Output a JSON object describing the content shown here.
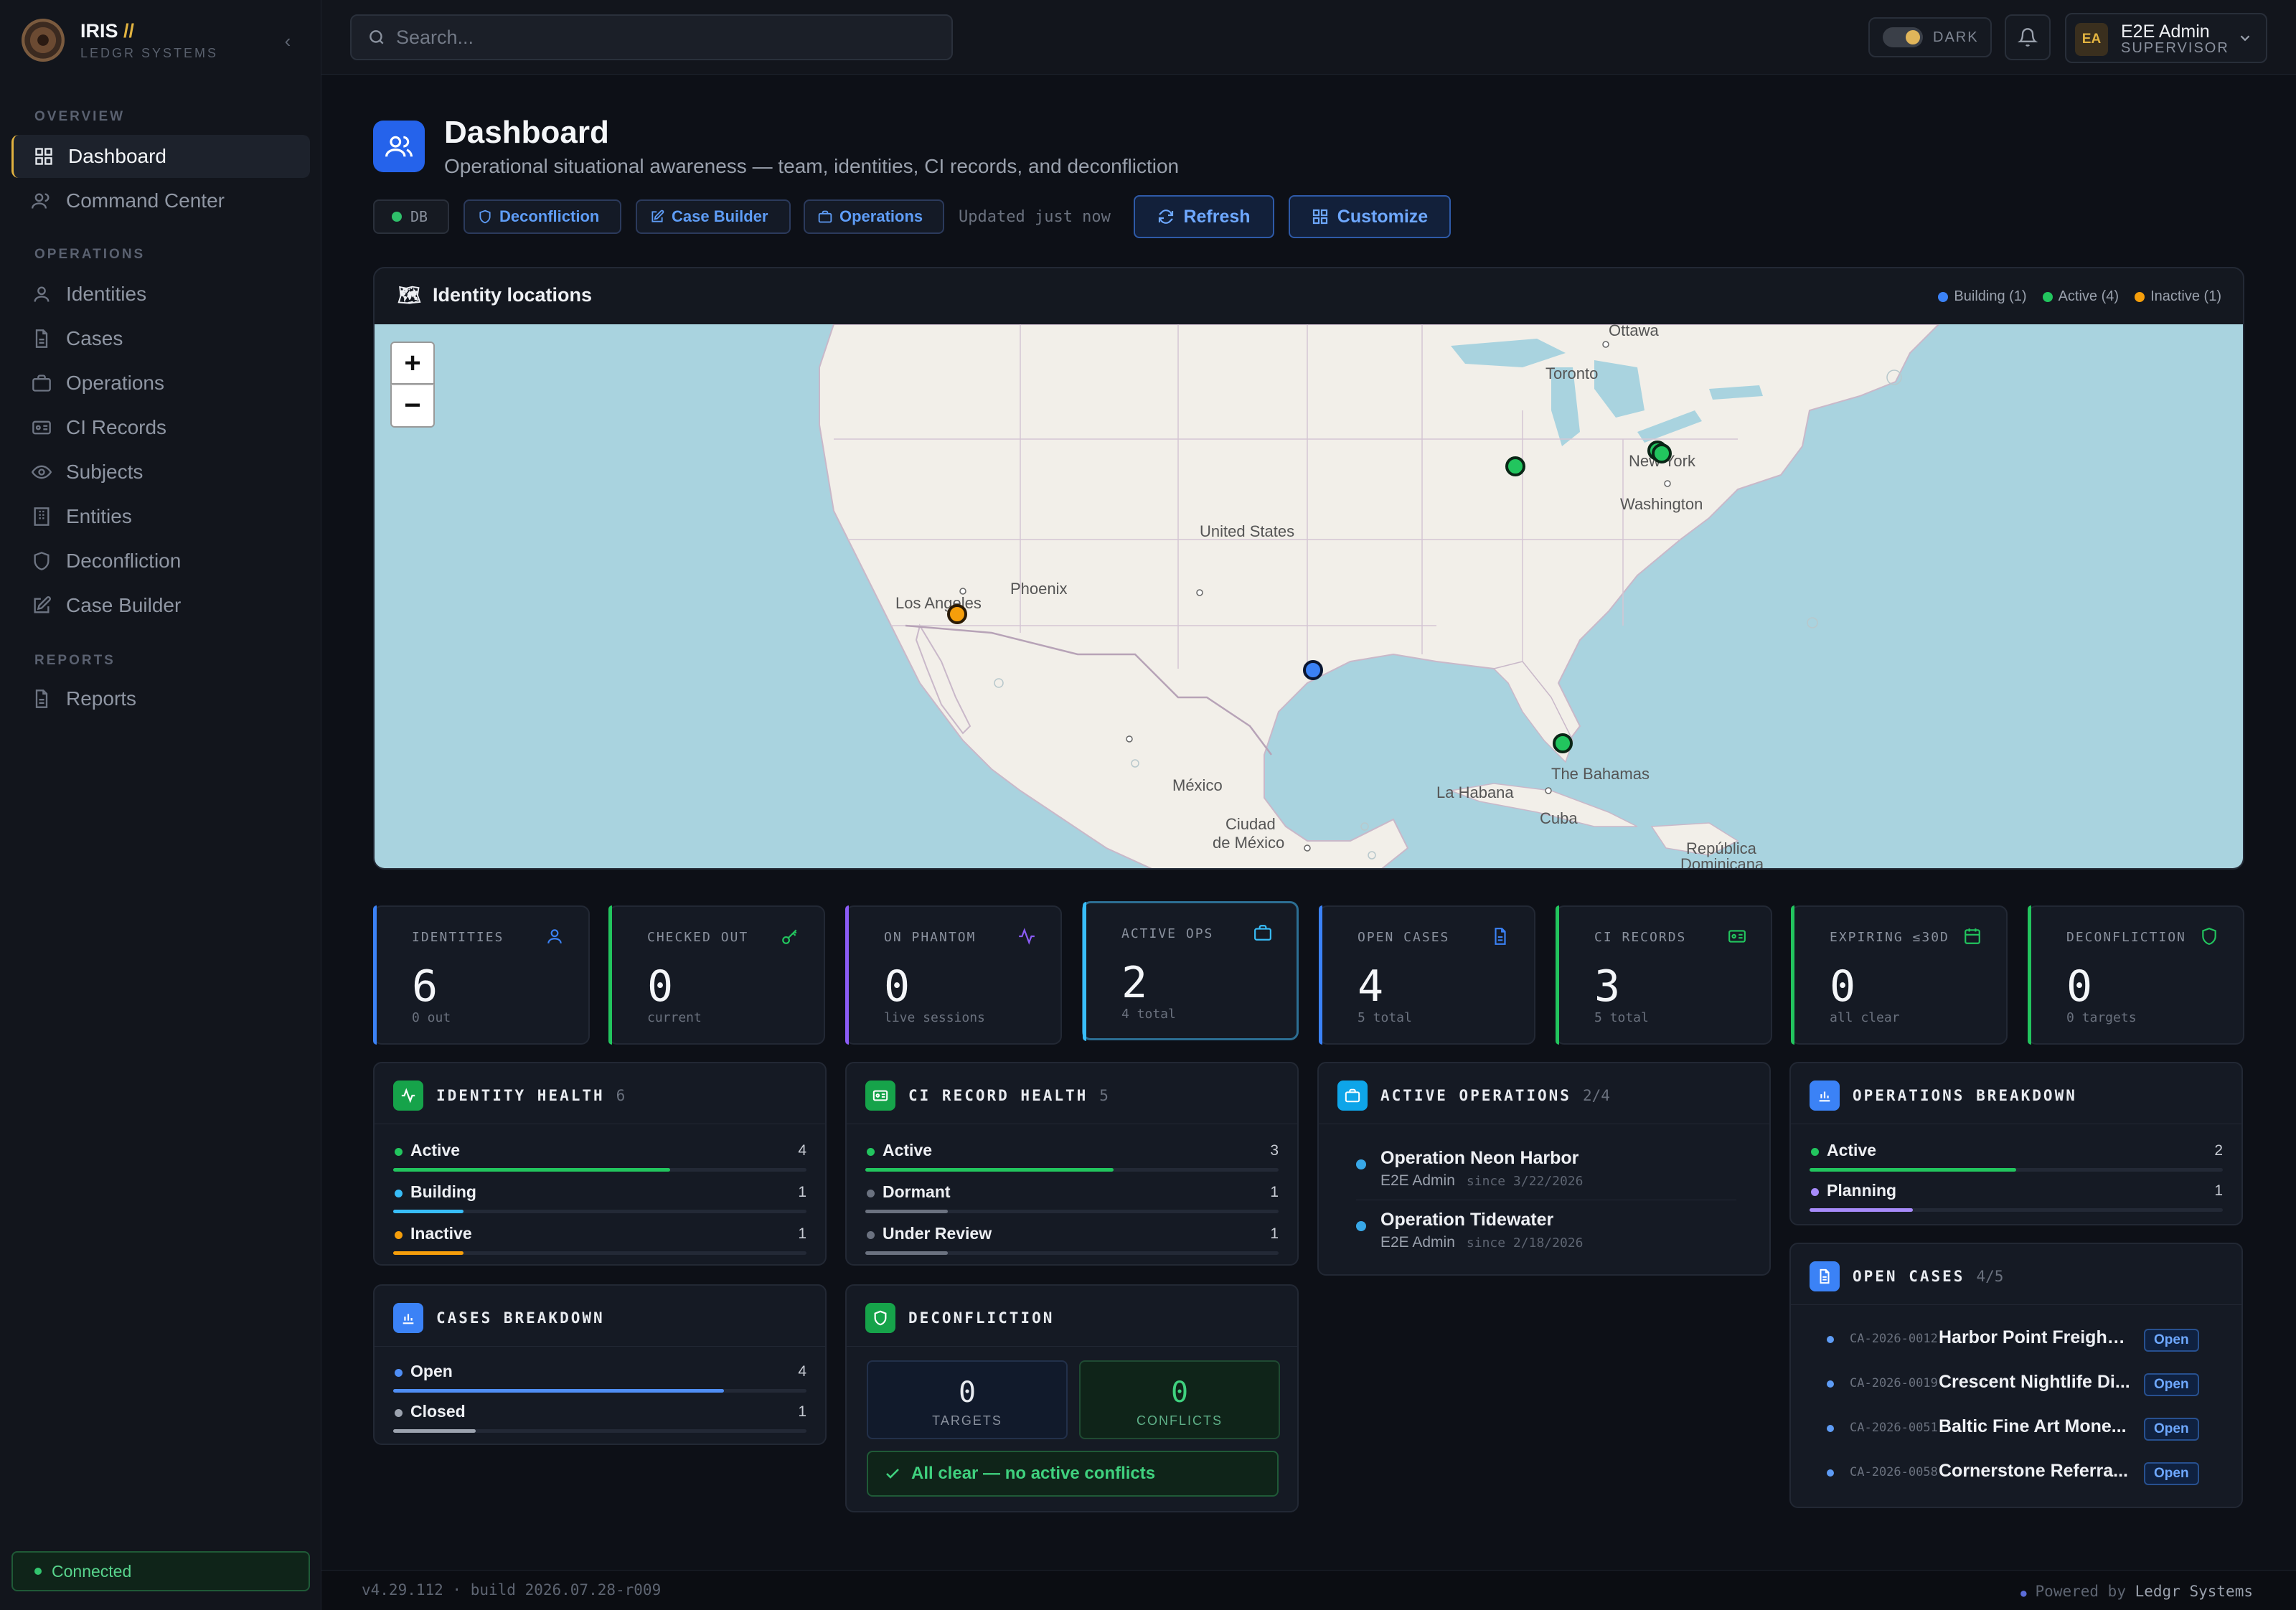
{
  "app": {
    "name": "IRIS",
    "slashes": "//",
    "subtitle": "LEDGR SYSTEMS"
  },
  "sidebar": {
    "sections": [
      {
        "title": "OVERVIEW"
      },
      {
        "title": "OPERATIONS"
      },
      {
        "title": "REPORTS"
      }
    ],
    "items": [
      {
        "label": "Dashboard",
        "icon": "grid-icon",
        "active": true
      },
      {
        "label": "Command Center",
        "icon": "users-icon"
      },
      {
        "label": "Identities",
        "icon": "user-icon"
      },
      {
        "label": "Cases",
        "icon": "file-icon"
      },
      {
        "label": "Operations",
        "icon": "briefcase-icon"
      },
      {
        "label": "CI Records",
        "icon": "id-card-icon"
      },
      {
        "label": "Subjects",
        "icon": "eye-icon"
      },
      {
        "label": "Entities",
        "icon": "building-icon"
      },
      {
        "label": "Deconfliction",
        "icon": "shield-icon"
      },
      {
        "label": "Case Builder",
        "icon": "edit-icon"
      },
      {
        "label": "Reports",
        "icon": "file-icon"
      }
    ],
    "status": "Connected"
  },
  "topbar": {
    "search_placeholder": "Search...",
    "theme_label": "DARK",
    "user": {
      "initials": "EA",
      "name": "E2E Admin",
      "role": "SUPERVISOR"
    }
  },
  "header": {
    "title": "Dashboard",
    "subtitle": "Operational situational awareness — team, identities, CI records, and deconfliction",
    "db_label": "DB",
    "chips": [
      "Deconfliction",
      "Case Builder",
      "Operations"
    ],
    "updated": "Updated just now",
    "refresh": "Refresh",
    "customize": "Customize"
  },
  "map": {
    "title": "Identity locations",
    "legend": [
      {
        "label": "Building (1)",
        "color": "#3b82f6"
      },
      {
        "label": "Active (4)",
        "color": "#22c55e"
      },
      {
        "label": "Inactive (1)",
        "color": "#f59e0b"
      }
    ],
    "zoom_in": "+",
    "zoom_out": "−",
    "labels": [
      "Ottawa",
      "Toronto",
      "New York",
      "Washington",
      "United States",
      "Phoenix",
      "Los Angeles",
      "México",
      "Ciudad",
      "de México",
      "La Habana",
      "The Bahamas",
      "Cuba",
      "República",
      "Dominicana"
    ]
  },
  "stats": [
    {
      "label": "IDENTITIES",
      "value": "6",
      "sub": "0 out",
      "color": "#3b82f6",
      "icon": "user-icon"
    },
    {
      "label": "CHECKED OUT",
      "value": "0",
      "sub": "current",
      "color": "#22c55e",
      "icon": "key-icon"
    },
    {
      "label": "ON PHANTOM",
      "value": "0",
      "sub": "live sessions",
      "color": "#8b5cf6",
      "icon": "activity-icon"
    },
    {
      "label": "ACTIVE OPS",
      "value": "2",
      "sub": "4 total",
      "color": "#38bdf8",
      "icon": "briefcase-icon"
    },
    {
      "label": "OPEN CASES",
      "value": "4",
      "sub": "5 total",
      "color": "#3b82f6",
      "icon": "file-icon"
    },
    {
      "label": "CI RECORDS",
      "value": "3",
      "sub": "5 total",
      "color": "#22c55e",
      "icon": "id-card-icon"
    },
    {
      "label": "EXPIRING ≤30D",
      "value": "0",
      "sub": "all clear",
      "color": "#22c55e",
      "icon": "calendar-icon"
    },
    {
      "label": "DECONFLICTION",
      "value": "0",
      "sub": "0 targets",
      "color": "#22c55e",
      "icon": "shield-icon"
    }
  ],
  "identity_health": {
    "title": "IDENTITY HEALTH",
    "count": "6",
    "rows": [
      {
        "label": "Active",
        "value": "4",
        "fraction": 0.67,
        "color": "#22c55e"
      },
      {
        "label": "Building",
        "value": "1",
        "fraction": 0.17,
        "color": "#38bdf8"
      },
      {
        "label": "Inactive",
        "value": "1",
        "fraction": 0.17,
        "color": "#f59e0b"
      }
    ]
  },
  "ci_health": {
    "title": "CI RECORD HEALTH",
    "count": "5",
    "rows": [
      {
        "label": "Active",
        "value": "3",
        "fraction": 0.6,
        "color": "#22c55e"
      },
      {
        "label": "Dormant",
        "value": "1",
        "fraction": 0.2,
        "color": "#6b7280"
      },
      {
        "label": "Under Review",
        "value": "1",
        "fraction": 0.2,
        "color": "#6b7280"
      }
    ]
  },
  "active_ops": {
    "title": "ACTIVE OPERATIONS",
    "count": "2/4",
    "items": [
      {
        "name": "Operation Neon Harbor",
        "owner": "E2E Admin",
        "since": "since 3/22/2026"
      },
      {
        "name": "Operation Tidewater",
        "owner": "E2E Admin",
        "since": "since 2/18/2026"
      }
    ]
  },
  "ops_breakdown": {
    "title": "OPERATIONS BREAKDOWN",
    "rows": [
      {
        "label": "Active",
        "value": "2",
        "fraction": 0.5,
        "color": "#22c55e"
      },
      {
        "label": "Planning",
        "value": "1",
        "fraction": 0.25,
        "color": "#a78bfa"
      }
    ]
  },
  "cases_breakdown": {
    "title": "CASES BREAKDOWN",
    "rows": [
      {
        "label": "Open",
        "value": "4",
        "fraction": 0.8,
        "color": "#4f8ef5"
      },
      {
        "label": "Closed",
        "value": "1",
        "fraction": 0.2,
        "color": "#9ca3af"
      }
    ]
  },
  "deconfliction": {
    "title": "DECONFLICTION",
    "targets_value": "0",
    "targets_label": "TARGETS",
    "conflicts_value": "0",
    "conflicts_label": "CONFLICTS",
    "status": "All clear — no active conflicts"
  },
  "open_cases": {
    "title": "OPEN CASES",
    "count": "4/5",
    "items": [
      {
        "id": "CA-2026-0012",
        "name": "Harbor Point Freight ...",
        "status": "Open"
      },
      {
        "id": "CA-2026-0019",
        "name": "Crescent Nightlife Di...",
        "status": "Open"
      },
      {
        "id": "CA-2026-0051",
        "name": "Baltic Fine Art Mone...",
        "status": "Open"
      },
      {
        "id": "CA-2026-0058",
        "name": "Cornerstone Referra...",
        "status": "Open"
      }
    ]
  },
  "footer": {
    "version": "v4.29.112 · build 2026.07.28-r009",
    "powered_prefix": "Powered by",
    "powered_name": "Ledgr Systems"
  }
}
